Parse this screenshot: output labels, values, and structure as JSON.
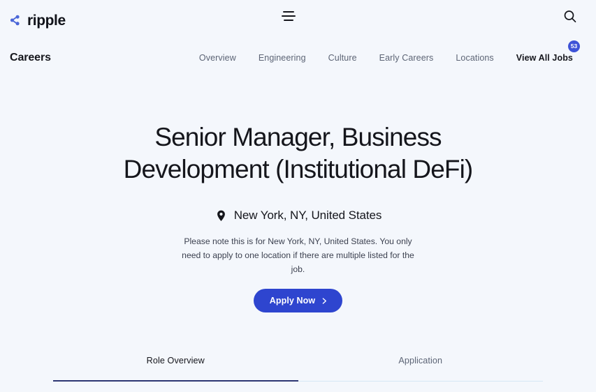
{
  "topbar": {
    "brand_name": "ripple",
    "brand_mark_icon": "ripple-dots-logo",
    "menu_icon": "hamburger-menu-icon",
    "search_icon": "search-icon"
  },
  "careers_nav": {
    "section_label": "Careers",
    "links": [
      {
        "label": "Overview"
      },
      {
        "label": "Engineering"
      },
      {
        "label": "Culture"
      },
      {
        "label": "Early Careers"
      },
      {
        "label": "Locations"
      }
    ],
    "view_all_jobs": {
      "label": "View All Jobs",
      "badge_count": "53",
      "badge_color": "#3e53d7"
    }
  },
  "hero": {
    "job_title": "Senior Manager, Business Development (Institutional DeFi)",
    "location_icon": "map-pin-icon",
    "location": "New York, NY, United States",
    "note": "Please note this is for New York, NY, United States. You only need to apply to one location if there are multiple listed for the job.",
    "apply_button": {
      "label": "Apply Now",
      "icon": "chevron-right-icon",
      "color": "#2e45cf"
    }
  },
  "tabs": [
    {
      "label": "Role Overview",
      "active": true
    },
    {
      "label": "Application",
      "active": false
    }
  ],
  "theme": {
    "page_background": "#f4f7fc",
    "text_primary": "#15161c",
    "text_muted": "#5c6475",
    "accent_blue": "#2e45cf",
    "tab_active_underline": "#2c3572",
    "tab_inactive_underline": "#d5e7f5"
  }
}
